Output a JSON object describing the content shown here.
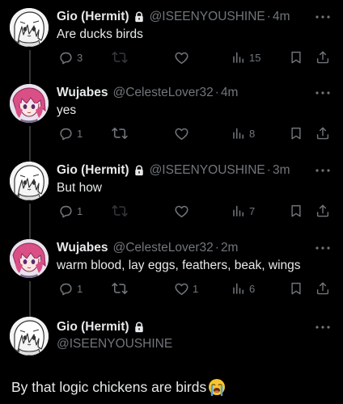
{
  "tweets": [
    {
      "name": "Gio (Hermit)",
      "handle": "@ISEENYOUSHINE",
      "dot": "·",
      "time": "4m",
      "text": "Are ducks birds",
      "replies": "3",
      "retweets": "",
      "likes": "",
      "views": "15",
      "locked": true,
      "avatar": "hermit"
    },
    {
      "name": "Wujabes",
      "handle": "@CelesteLover32",
      "dot": "·",
      "time": "4m",
      "text": "yes",
      "replies": "1",
      "retweets": "",
      "likes": "",
      "views": "8",
      "locked": false,
      "avatar": "wujabes"
    },
    {
      "name": "Gio (Hermit)",
      "handle": "@ISEENYOUSHINE",
      "dot": "·",
      "time": "3m",
      "text": "But how",
      "replies": "1",
      "retweets": "",
      "likes": "",
      "views": "7",
      "locked": true,
      "avatar": "hermit"
    },
    {
      "name": "Wujabes",
      "handle": "@CelesteLover32",
      "dot": "·",
      "time": "2m",
      "text": "warm blood, lay eggs, feathers, beak, wings",
      "replies": "1",
      "retweets": "",
      "likes": "1",
      "views": "6",
      "locked": false,
      "avatar": "wujabes"
    }
  ],
  "focused": {
    "name": "Gio (Hermit)",
    "handle": "@ISEENYOUSHINE",
    "text": "By that logic chickens are birds",
    "emoji": "loudly-crying-face-icon"
  },
  "icons": {
    "reply": "reply-icon",
    "retweet": "retweet-icon",
    "like": "heart-icon",
    "views": "views-icon",
    "bookmark": "bookmark-icon",
    "share": "share-icon",
    "lock": "lock-icon",
    "more": "more-icon"
  },
  "colors": {
    "background": "#000000",
    "text": "#e7e9ea",
    "secondary": "#71767b",
    "thread_line": "#333639"
  }
}
